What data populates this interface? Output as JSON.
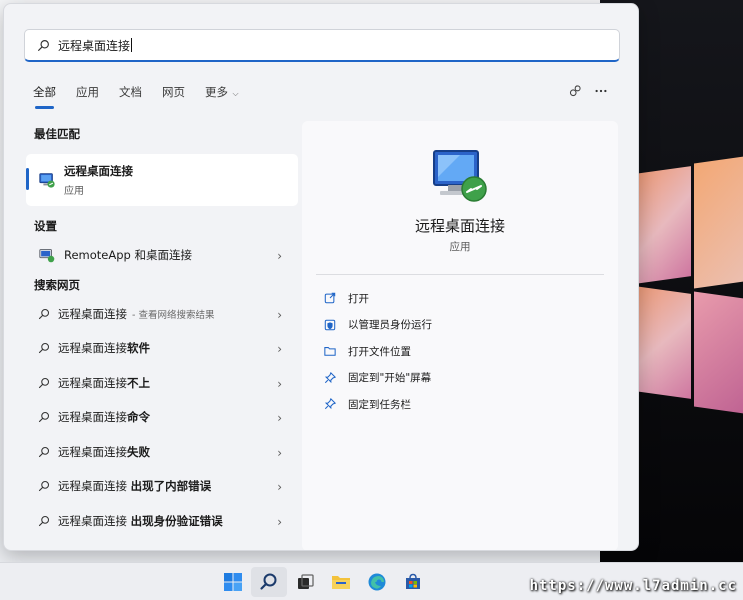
{
  "search": {
    "value": "远程桌面连接"
  },
  "tabs": [
    {
      "label": "全部",
      "active": true
    },
    {
      "label": "应用"
    },
    {
      "label": "文档"
    },
    {
      "label": "网页"
    },
    {
      "label": "更多",
      "dropdown": true
    }
  ],
  "top_icons": [
    "share-icon",
    "more-icon"
  ],
  "best_match": {
    "section": "最佳匹配",
    "name": "远程桌面连接",
    "type": "应用"
  },
  "settings": {
    "section": "设置",
    "items": [
      {
        "label": "RemoteApp 和桌面连接"
      }
    ]
  },
  "web": {
    "section": "搜索网页",
    "items": [
      {
        "prefix": "远程桌面连接",
        "bold": "",
        "hint": " - 查看网络搜索结果"
      },
      {
        "prefix": "远程桌面连接",
        "bold": "软件",
        "hint": ""
      },
      {
        "prefix": "远程桌面连接",
        "bold": "不上",
        "hint": ""
      },
      {
        "prefix": "远程桌面连接",
        "bold": "命令",
        "hint": ""
      },
      {
        "prefix": "远程桌面连接",
        "bold": "失败",
        "hint": ""
      },
      {
        "prefix": "远程桌面连接 ",
        "bold": "出现了内部错误",
        "hint": ""
      },
      {
        "prefix": "远程桌面连接 ",
        "bold": "出现身份验证错误",
        "hint": ""
      }
    ]
  },
  "detail": {
    "title": "远程桌面连接",
    "subtitle": "应用",
    "actions": [
      {
        "label": "打开",
        "icon": "open-icon"
      },
      {
        "label": "以管理员身份运行",
        "icon": "shield-icon"
      },
      {
        "label": "打开文件位置",
        "icon": "folder-icon"
      },
      {
        "label": "固定到\"开始\"屏幕",
        "icon": "pin-icon"
      },
      {
        "label": "固定到任务栏",
        "icon": "pin-icon"
      }
    ]
  },
  "taskbar": [
    "windows-start-icon",
    "search-icon",
    "task-view-icon",
    "file-explorer-icon",
    "edge-icon",
    "store-icon"
  ],
  "watermark": "https://www.l7admin.cc",
  "colors": {
    "accent": "#1f65c7"
  }
}
